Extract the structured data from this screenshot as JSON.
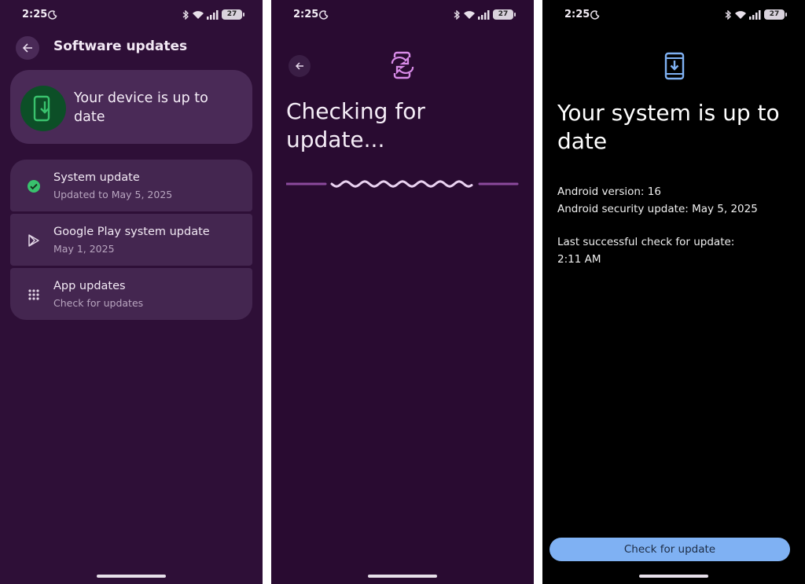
{
  "screens": [
    {
      "status": {
        "time": "2:25",
        "battery": "27"
      },
      "title": "Software updates",
      "hero": {
        "text": "Your device is up to date"
      },
      "items": [
        {
          "title": "System update",
          "subtitle": "Updated to May 5, 2025",
          "icon": "check-circle-icon"
        },
        {
          "title": "Google Play system update",
          "subtitle": "May 1, 2025",
          "icon": "play-icon"
        },
        {
          "title": "App updates",
          "subtitle": "Check for updates",
          "icon": "grid-icon"
        }
      ]
    },
    {
      "status": {
        "time": "2:25",
        "battery": "27"
      },
      "heading": "Checking for update...",
      "icon": "phone-sync-icon"
    },
    {
      "status": {
        "time": "2:25",
        "battery": "27"
      },
      "heading": "Your system is up to date",
      "android_version": "Android version: 16",
      "security_update": "Android security update: May 5, 2025",
      "last_check_label": "Last successful check for update:",
      "last_check_time": "2:11 AM",
      "button_label": "Check for update",
      "icon": "phone-download-icon"
    }
  ],
  "colors": {
    "screen1_bg": "#2e0f37",
    "screen2_bg": "#290b31",
    "screen3_bg": "#000000",
    "accent_green": "#39c26d",
    "accent_purple": "#d88be8",
    "accent_blue": "#7fb1f3"
  }
}
